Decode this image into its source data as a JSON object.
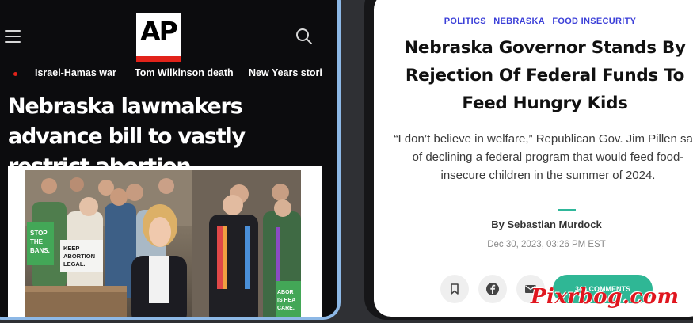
{
  "left_panel": {
    "logo_text": "AP",
    "topics": [
      "Israel-Hamas war",
      "Tom Wilkinson death",
      "New Years stori"
    ],
    "headline": "Nebraska lawmakers advance bill to vastly restrict abortion",
    "photo_signs": [
      "STOP THE BANS.",
      "KEEP ABORTION LEGAL.",
      "ABORTION IS HEALTH CARE."
    ]
  },
  "right_panel": {
    "tags": [
      "POLITICS",
      "NEBRASKA",
      "FOOD INSECURITY"
    ],
    "title": "Nebraska Governor Stands By Rejection Of Federal Funds To Feed Hungry Kids",
    "dek": "“I don’t believe in welfare,” Republican Gov. Jim Pillen said of declining a federal program that would feed food-insecure children in the summer of 2024.",
    "byline_prefix": "By",
    "author": "Sebastian Murdock",
    "date": "Dec 30, 2023, 03:26 PM EST",
    "comments_label": "344 COMMENTS",
    "accent_color": "#2fb795",
    "tag_color": "#3b3fd8"
  },
  "watermark": "Pixrbog.com",
  "icons": [
    "menu-icon",
    "search-icon",
    "bookmark-icon",
    "facebook-icon",
    "mail-icon"
  ]
}
